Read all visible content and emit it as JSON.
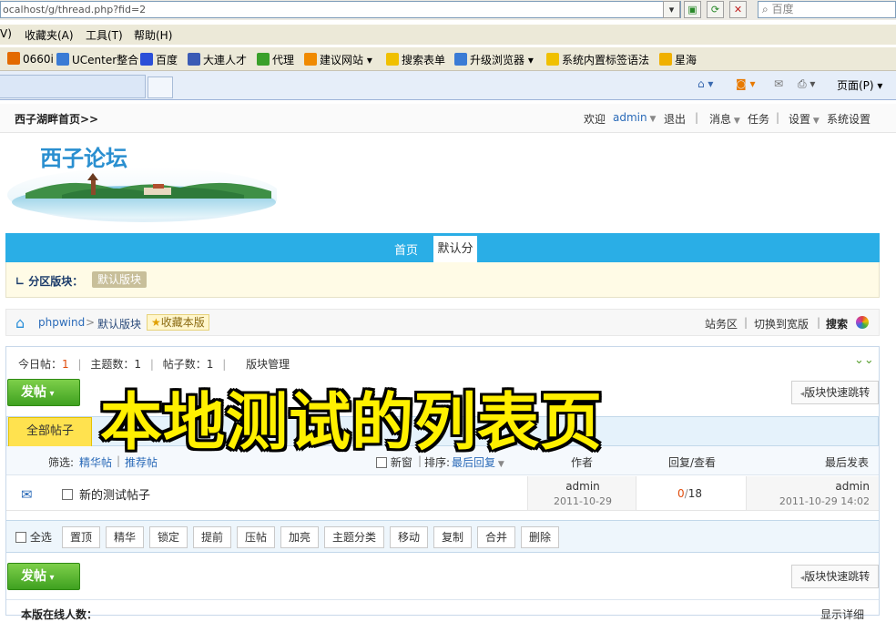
{
  "browser": {
    "address": "ocalhost/g/thread.php?fid=2",
    "search_placeholder": "百度",
    "menu": [
      "V)",
      "收藏夹(A)",
      "工具(T)",
      "帮助(H)"
    ],
    "favorites": [
      "0660i",
      "UCenter整合",
      "百度",
      "大連人才",
      "代理",
      "建议网站",
      "搜索表单",
      "升级浏览器",
      "系统内置标签语法",
      "星海"
    ],
    "command_bar_page": "页面(P)"
  },
  "topbar": {
    "site_link": "西子湖畔首页>>",
    "welcome": "欢迎",
    "username": "admin",
    "logout": "退出",
    "messages": "消息",
    "tasks": "任务",
    "settings": "设置",
    "system_settings": "系统设置"
  },
  "logo": {
    "text": "西子论坛"
  },
  "nav": {
    "home": "首页",
    "current": "默认分类"
  },
  "subnav": {
    "label": "分区版块：",
    "board": "默认版块"
  },
  "breadcrumb": {
    "root": "phpwind",
    "sep": ">",
    "board": "默认版块",
    "favorite": "收藏本版",
    "service_area": "站务区",
    "wide_toggle": "切换到宽版",
    "search": "搜索"
  },
  "stats": {
    "today_label": "今日帖：",
    "today_value": "1",
    "topics_label": "主题数：",
    "topics_value": "1",
    "posts_label": "帖子数：",
    "posts_value": "1",
    "manage": "版块管理"
  },
  "buttons": {
    "post": "发帖",
    "quick_jump": "版块快速跳转"
  },
  "tabs": {
    "all_posts": "全部帖子"
  },
  "list_header": {
    "filter_label": "筛选:",
    "filter_digest": "精华帖",
    "filter_recommend": "推荐帖",
    "new_window": "新窗",
    "sort_label": "排序:",
    "sort_value": "最后回复",
    "author": "作者",
    "reply_view": "回复/查看",
    "last_post": "最后发表"
  },
  "threads": [
    {
      "title": "新的测试帖子",
      "author": "admin",
      "author_date": "2011-10-29",
      "replies": "0",
      "views": "18",
      "last_user": "admin",
      "last_time": "2011-10-29 14:02"
    }
  ],
  "actions": {
    "select_all": "全选",
    "items": [
      "置顶",
      "精华",
      "锁定",
      "提前",
      "压帖",
      "加亮",
      "主题分类",
      "移动",
      "复制",
      "合并",
      "删除"
    ]
  },
  "online": {
    "label": "本版在线人数：",
    "detail": "显示详细"
  },
  "caption": "本地测试的列表页",
  "colors": {
    "nav_blue": "#2aaee6",
    "post_green": "#3fa120",
    "caption_yellow": "#fff000",
    "reply_red": "#e04c0c"
  }
}
